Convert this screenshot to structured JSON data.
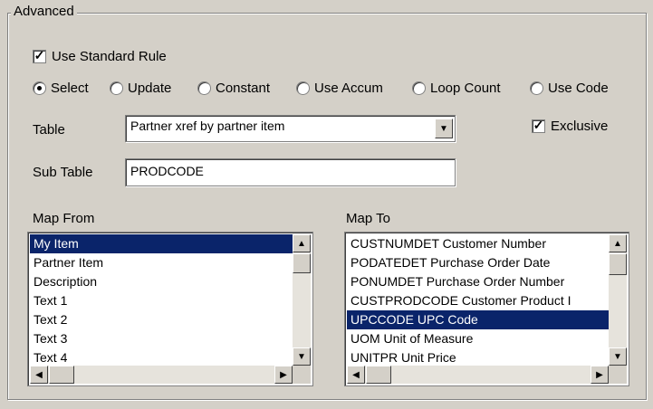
{
  "group": {
    "title": "Advanced"
  },
  "use_standard_rule": {
    "label": "Use Standard Rule",
    "checked": true
  },
  "radios": [
    {
      "label": "Select",
      "selected": true
    },
    {
      "label": "Update",
      "selected": false
    },
    {
      "label": "Constant",
      "selected": false
    },
    {
      "label": "Use Accum",
      "selected": false
    },
    {
      "label": "Loop Count",
      "selected": false
    },
    {
      "label": "Use Code",
      "selected": false
    }
  ],
  "table": {
    "label": "Table",
    "value": "Partner xref by partner item"
  },
  "exclusive": {
    "label": "Exclusive",
    "checked": true
  },
  "sub_table": {
    "label": "Sub Table",
    "value": "PRODCODE"
  },
  "map_from": {
    "label": "Map From",
    "items": [
      "My Item",
      "Partner Item",
      "Description",
      "Text 1",
      "Text 2",
      "Text 3",
      "Text 4"
    ],
    "selected_index": 0
  },
  "map_to": {
    "label": "Map To",
    "items": [
      "CUSTNUMDET Customer Number",
      "PODATEDET Purchase Order Date",
      "PONUMDET Purchase Order Number",
      "CUSTPRODCODE Customer Product I",
      "UPCCODE UPC Code",
      "UOM Unit of Measure",
      "UNITPR Unit Price"
    ],
    "selected_index": 4
  },
  "icons": {
    "arrow_up": "▲",
    "arrow_down": "▼",
    "arrow_left": "◀",
    "arrow_right": "▶",
    "check": "✓"
  }
}
